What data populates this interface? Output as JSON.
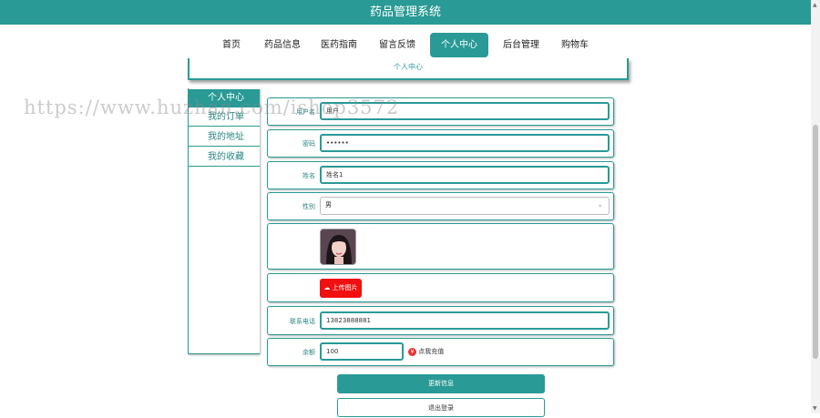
{
  "site": {
    "title": "药品管理系统"
  },
  "nav": [
    "首页",
    "药品信息",
    "医药指南",
    "留言反馈",
    "个人中心",
    "后台管理",
    "购物车"
  ],
  "breadcrumb": "个人中心",
  "side_menu": [
    "个人中心",
    "我的订单",
    "我的地址",
    "我的收藏"
  ],
  "form": {
    "username_label": "用户名",
    "username_value": "用户",
    "password_label": "密码",
    "password_value": "••••••",
    "name_label": "姓名",
    "name_value": "姓名1",
    "gender_label": "性别",
    "gender_value": "男",
    "upload_label": "上传图片",
    "phone_label": "联系电话",
    "phone_value": "13823888881",
    "balance_label": "余额",
    "balance_value": "100",
    "recharge_label": "点我充值"
  },
  "buttons": {
    "update": "更新信息",
    "logout": "退出登录"
  },
  "watermark": "https://www.huzhan.com/ishop3572",
  "colors": {
    "accent": "#2a9a96",
    "upload": "#f01010"
  }
}
